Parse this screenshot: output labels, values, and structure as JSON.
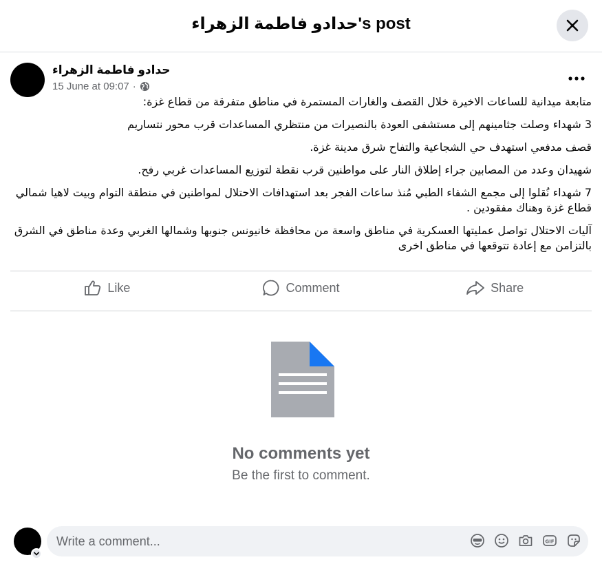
{
  "header": {
    "title": "حدادو فاطمة الزهراء's post"
  },
  "post": {
    "author": "حدادو فاطمة الزهراء",
    "timestamp": "15 June at 09:07",
    "separator": "·",
    "paragraphs": [
      "متابعة ميدانية للساعات الاخيرة خلال القصف والغارات المستمرة في مناطق متفرقة من قطاع غزة:",
      "3 شهداء وصلت جثامينهم إلى مستشفى العودة بالنصيرات من منتظري المساعدات قرب محور نتساريم",
      "قصف مدفعي استهدف حي الشجاعية والتفاح شرق مدينة غزة.",
      "شهيدان وعدد من المصابين جراء إطلاق النار على مواطنين قرب نقطة لتوزيع المساعدات غربي رفح.",
      "7 شهداء نُقلوا إلى مجمع الشفاء الطبي مُنذ ساعات الفجر بعد استهدافات الاحتلال لمواطنين في منطقة التوام وبيت لاهيا شمالي قطاع غزة وهناك مفقودين .",
      "آليات الاحتلال تواصل عمليتها العسكرية في مناطق واسعة من محافظة خانيونس جنوبها وشمالها الغربي وعدة مناطق في الشرق بالتزامن مع إعادة تتوقعها في مناطق اخرى"
    ]
  },
  "actions": {
    "like": "Like",
    "comment": "Comment",
    "share": "Share"
  },
  "empty_state": {
    "title": "No comments yet",
    "subtitle": "Be the first to comment."
  },
  "composer": {
    "placeholder": "Write a comment..."
  },
  "colors": {
    "secondary_text": "#65676b",
    "divider": "#ced0d4",
    "accent": "#1877f2",
    "doc_gray": "#a8abb1"
  }
}
